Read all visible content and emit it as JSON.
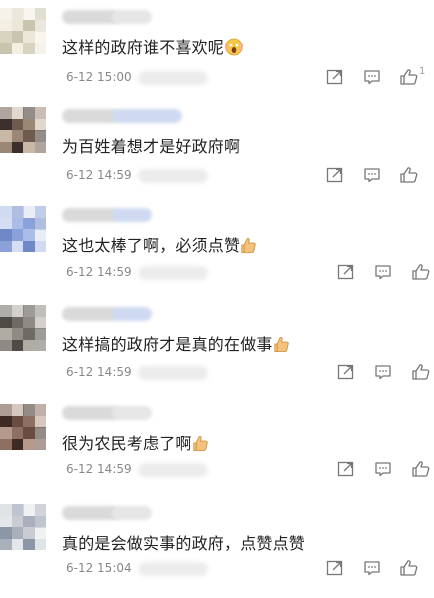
{
  "comments": [
    {
      "text": "这样的政府谁不喜欢呢",
      "emoji": "scream-face",
      "time": "6-12 15:00",
      "like_count": "1",
      "colors": [
        "#ece8d8",
        "#d9d4c0",
        "#f3efe2",
        "#c9c4ad"
      ]
    },
    {
      "text": "为百姓着想才是好政府啊",
      "emoji": "",
      "time": "6-12 14:59",
      "like_count": "",
      "colors": [
        "#6f5b4e",
        "#c9b8a6",
        "#3a2f2a",
        "#9c8676"
      ]
    },
    {
      "text": "这也太棒了啊，必须点赞",
      "emoji": "thumbs-up",
      "time": "6-12 14:59",
      "like_count": "",
      "colors": [
        "#a9bde8",
        "#6e88c8",
        "#d6def3",
        "#8aa2d9"
      ]
    },
    {
      "text": "这样搞的政府才是真的在做事",
      "emoji": "thumbs-up",
      "time": "6-12 14:59",
      "like_count": "",
      "colors": [
        "#6e6a64",
        "#b0aca4",
        "#4e4a45",
        "#8f8b84"
      ]
    },
    {
      "text": "很为农民考虑了啊",
      "emoji": "thumbs-up",
      "time": "6-12 14:59",
      "like_count": "",
      "colors": [
        "#6a4b3f",
        "#b59a8b",
        "#3d2a23",
        "#8e7062"
      ]
    },
    {
      "text": "真的是会做实事的政府，点赞点赞",
      "emoji": "",
      "time": "6-12 15:04",
      "like_count": "",
      "colors": [
        "#c9cdd3",
        "#8b96a6",
        "#e4e6ea",
        "#a9b0bc"
      ]
    }
  ],
  "icons": {
    "share": "share-icon",
    "reply": "comment-icon",
    "like": "thumbs-up-icon"
  },
  "accent": "#f0b85a"
}
